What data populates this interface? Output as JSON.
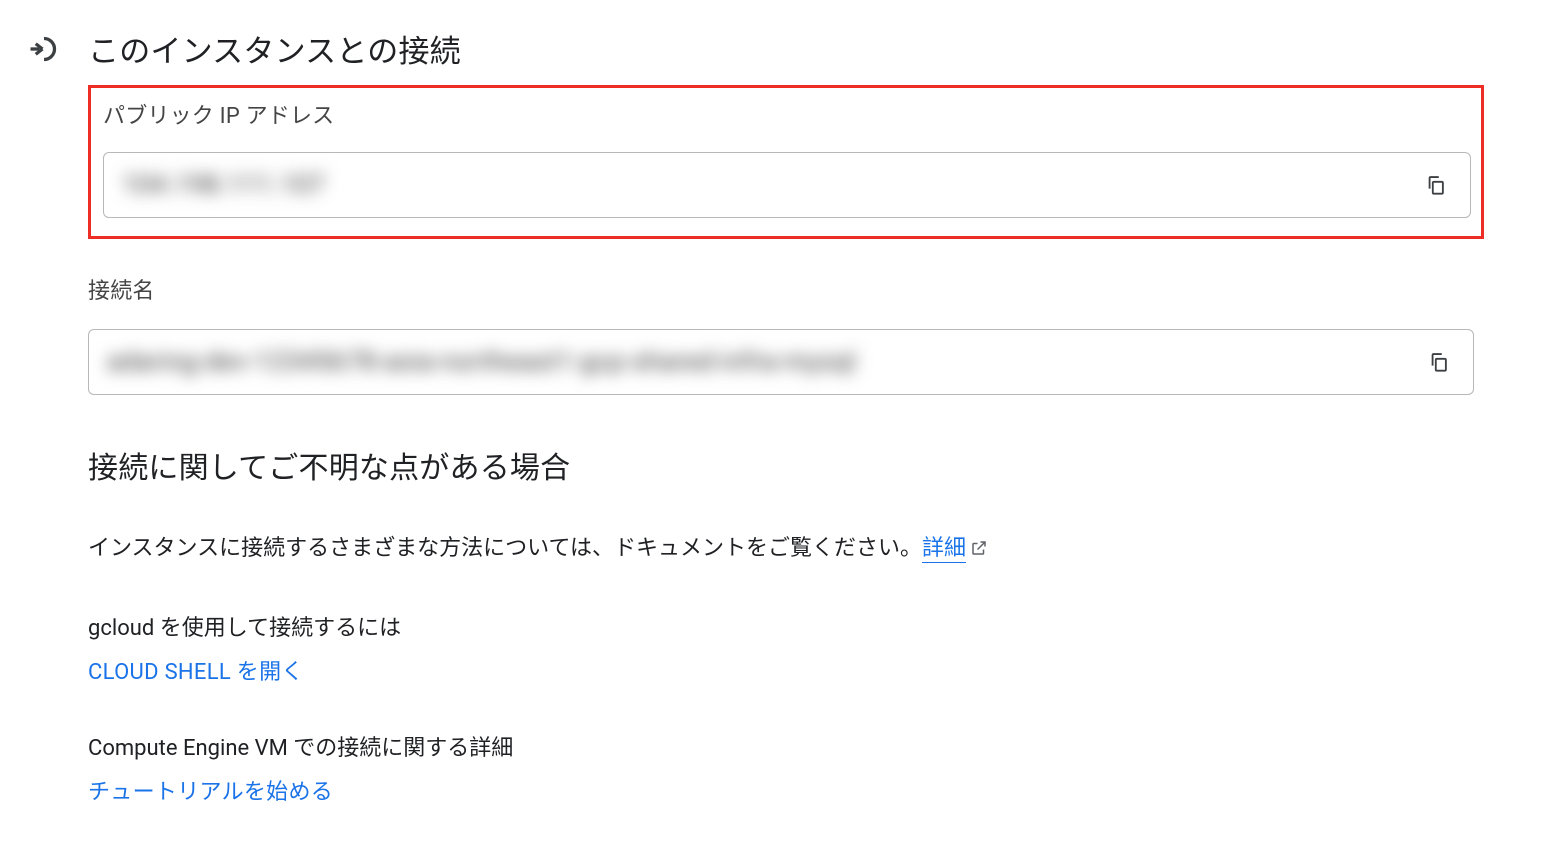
{
  "header": {
    "title": "このインスタンスとの接続"
  },
  "public_ip": {
    "label": "パブリック IP アドレス",
    "value": "104.198.111.107"
  },
  "connection_name": {
    "label": "接続名",
    "value": "adaring-dev-12345678-asia-northeast1-gcp-shared-infra-mysql"
  },
  "help": {
    "heading": "接続に関してご不明な点がある場合",
    "body_prefix": "インスタンスに接続するさまざまな方法については、ドキュメントをご覧ください。",
    "details_link": "詳細"
  },
  "gcloud": {
    "heading": "gcloud を使用して接続するには",
    "action": "CLOUD SHELL を開く"
  },
  "compute": {
    "heading": "Compute Engine VM での接続に関する詳細",
    "action": "チュートリアルを始める"
  }
}
